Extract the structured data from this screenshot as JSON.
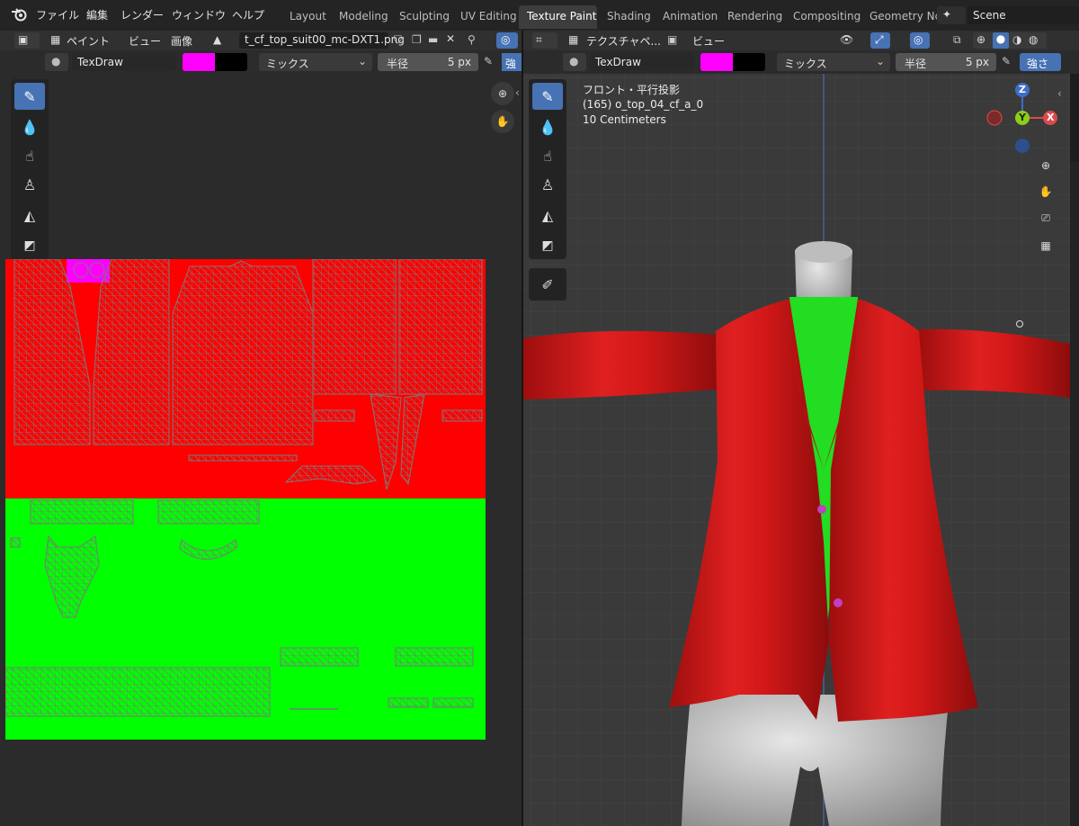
{
  "menu": [
    "ファイル",
    "編集",
    "レンダー",
    "ウィンドウ",
    "ヘルプ"
  ],
  "workspaces": [
    "Layout",
    "Modeling",
    "Sculpting",
    "UV Editing",
    "Texture Paint",
    "Shading",
    "Animation",
    "Rendering",
    "Compositing",
    "Geometry Nc"
  ],
  "active_workspace": "Texture Paint",
  "scene_name": "Scene",
  "image_editor": {
    "mode_label": "ペイント",
    "view_menu": "ビュー",
    "image_menu": "画像",
    "image_name": "t_cf_top_suit00_mc-DXT1.png",
    "brush_name": "TexDraw",
    "blend_mode": "ミックス",
    "radius_label": "半径",
    "radius_value": "5 px",
    "strength_label": "強"
  },
  "viewport": {
    "mode_label": "テクスチャペ...",
    "view_menu": "ビュー",
    "brush_name": "TexDraw",
    "blend_mode": "ミックス",
    "radius_label": "半径",
    "radius_value": "5 px",
    "strength_label": "強さ",
    "overlay_line1": "フロント・平行投影",
    "overlay_line2": "(165) o_top_04_cf_a_0",
    "overlay_line3": "10 Centimeters",
    "gizmo": {
      "z": "Z",
      "y": "Y",
      "x": "X"
    }
  },
  "colors": {
    "brush_primary": "#ff00ff",
    "brush_secondary": "#000000",
    "accent": "#4772b3",
    "texture_red": "#ff0000",
    "texture_green": "#00ff00",
    "jacket_red": "#c81414",
    "shirt_green": "#22dd22"
  },
  "icons": [
    "blender-logo-icon",
    "paint-brush-icon",
    "soften-icon",
    "smear-icon",
    "clone-stamp-icon",
    "fill-icon",
    "mask-icon",
    "annotate-icon",
    "zoom-icon",
    "hand-pan-icon",
    "camera-icon",
    "grid-icon",
    "pin-icon",
    "close-icon"
  ]
}
